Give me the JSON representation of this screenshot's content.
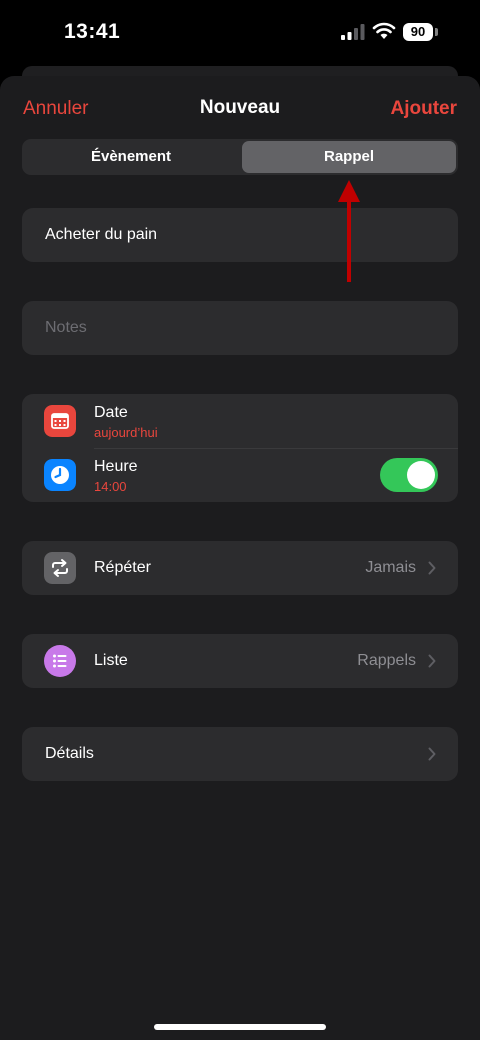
{
  "status_bar": {
    "time": "13:41",
    "battery": "90"
  },
  "nav": {
    "cancel_label": "Annuler",
    "title": "Nouveau",
    "add_label": "Ajouter"
  },
  "segmented": {
    "event_label": "Évènement",
    "reminder_label": "Rappel",
    "selected": "reminder"
  },
  "form": {
    "title_value": "Acheter du pain",
    "notes_placeholder": "Notes"
  },
  "date_row": {
    "label": "Date",
    "value": "aujourd’hui",
    "icon": "calendar-icon"
  },
  "time_row": {
    "label": "Heure",
    "value": "14:00",
    "icon": "clock-icon",
    "toggle_on": true
  },
  "repeat_row": {
    "label": "Répéter",
    "value": "Jamais",
    "icon": "repeat-icon"
  },
  "list_row": {
    "label": "Liste",
    "value": "Rappels",
    "icon": "list-icon"
  },
  "details_row": {
    "label": "Détails"
  },
  "colors": {
    "accent": "#e9463d",
    "toggle": "#34c759",
    "calendar": "#e9463d",
    "clock": "#0a84ff",
    "repeat": "#636366",
    "list": "#c879e9",
    "annotation_arrow": "#c00000"
  }
}
